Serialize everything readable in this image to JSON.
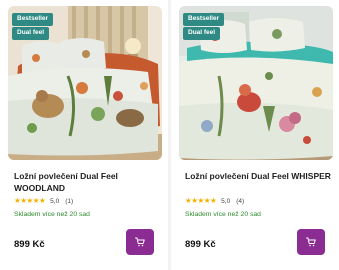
{
  "products": [
    {
      "badges": [
        "Bestseller",
        "Dual feel"
      ],
      "title": "Ložní povlečení Dual Feel WOODLAND",
      "rating": "5,0",
      "reviews": "(1)",
      "stars": 5,
      "stock": "Skladem více než 20 sad",
      "price": "899 Kč",
      "image_icon": "bedding-photo-woodland",
      "cart_icon": "cart-icon"
    },
    {
      "badges": [
        "Bestseller",
        "Dual feel"
      ],
      "title": "Ložní povlečení Dual Feel WHISPER",
      "rating": "5,0",
      "reviews": "(4)",
      "stars": 5,
      "stock": "Skladem více než 20 sad",
      "price": "899 Kč",
      "image_icon": "bedding-photo-whisper",
      "cart_icon": "cart-icon"
    }
  ],
  "colors": {
    "badge": "#2f8a85",
    "cart_button": "#8b2c93",
    "stock": "#2b8a2b",
    "stars": "#f4b000"
  }
}
